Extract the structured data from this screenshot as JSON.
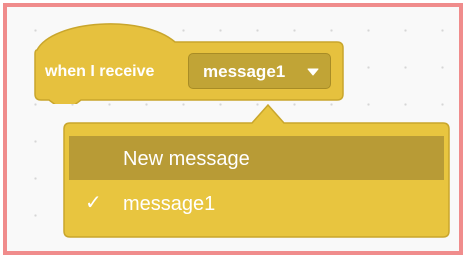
{
  "block": {
    "label": "when I receive",
    "selected_message": "message1",
    "dropdown_icon": "caret-down-icon",
    "color": "#e6c13e",
    "dropdown_color": "#c1a436"
  },
  "menu": {
    "items": [
      {
        "label": "New message",
        "checked": false,
        "highlighted": true
      },
      {
        "label": "message1",
        "checked": true,
        "highlighted": false
      }
    ],
    "check_icon": "checkmark-icon",
    "check_glyph": "✓",
    "highlight_color": "#b89b36",
    "background_color": "#e8c53f"
  }
}
